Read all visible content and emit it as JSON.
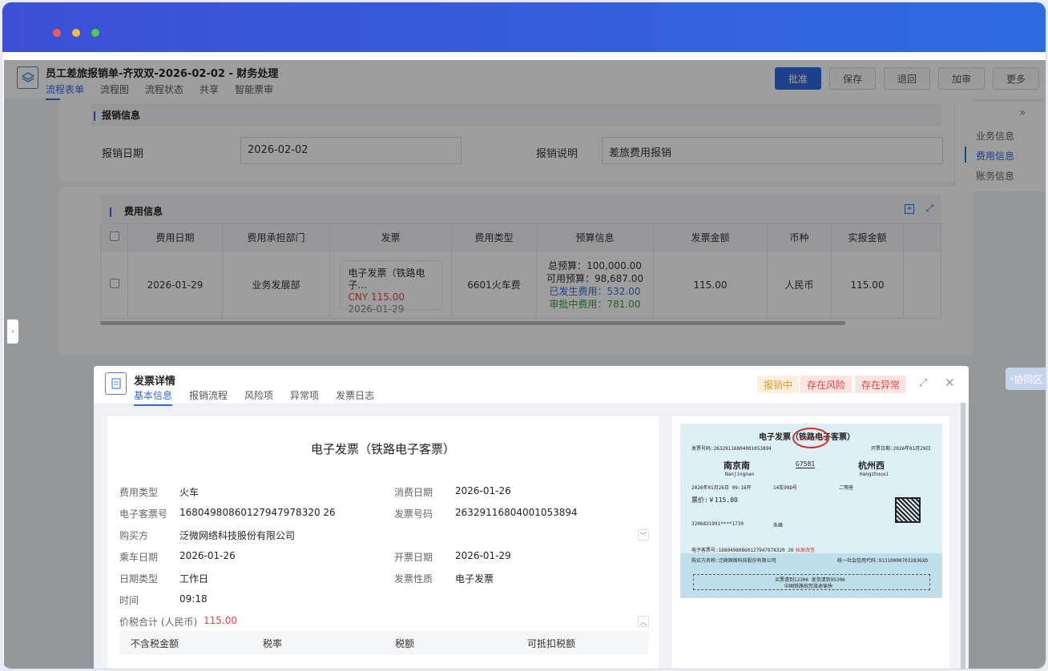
{
  "window": {
    "accent_gradient": [
      "#3d4fd6",
      "#2f6be0"
    ],
    "dots": [
      "#ee5b57",
      "#f6be3d",
      "#57c656"
    ]
  },
  "header": {
    "title": "员工差旅报销单-齐双双-2026-02-02 - 财务处理",
    "tabs": [
      "流程表单",
      "流程图",
      "流程状态",
      "共享",
      "智能票审"
    ],
    "buttons": {
      "approve": "批准",
      "save": "保存",
      "return": "退回",
      "add_review": "加审",
      "more": "更多"
    }
  },
  "reimb": {
    "section_title": "报销信息",
    "date_label": "报销日期",
    "date_value": "2026-02-02",
    "desc_label": "报销说明",
    "desc_value": "差旅费用报销"
  },
  "right_nav": {
    "items": [
      "业务信息",
      "费用信息",
      "账务信息"
    ],
    "active": "费用信息"
  },
  "fee": {
    "section_title": "费用信息",
    "columns": [
      "费用日期",
      "费用承担部门",
      "发票",
      "费用类型",
      "预算信息",
      "发票金额",
      "币种",
      "实报金额"
    ],
    "row": {
      "date": "2026-01-29",
      "dept": "业务发展部",
      "invoice_title": "电子发票（铁路电子...",
      "invoice_amount": "CNY  115.00",
      "invoice_date": "2026-01-29",
      "type": "6601火车费",
      "budget_total": "总预算：100,000.00",
      "budget_available": "可用预算：98,687.00",
      "budget_incurred": "已发生费用：532.00",
      "budget_pending": "审批中费用：781.00",
      "amount": "115.00",
      "currency": "人民币",
      "actual": "115.00"
    }
  },
  "collab_tab": "协同区",
  "modal": {
    "title": "发票详情",
    "tabs": [
      "基本信息",
      "报销流程",
      "风险项",
      "异常项",
      "发票日志"
    ],
    "badges": {
      "reimbursing": "报销中",
      "risk": "存在风险",
      "abnormal": "存在异常"
    },
    "doc_title": "电子发票（铁路电子客票）",
    "fields": {
      "fee_type_label": "费用类型",
      "fee_type": "火车",
      "consume_date_label": "消费日期",
      "consume_date": "2026-01-26",
      "ticket_no_label": "电子客票号",
      "ticket_no": "16804980860127947978320 26",
      "invoice_no_label": "发票号码",
      "invoice_no": "26329116804001053894",
      "buyer_label": "购买方",
      "buyer": "泛微网络科技股份有限公司",
      "ride_date_label": "乘车日期",
      "ride_date": "2026-01-26",
      "issue_date_label": "开票日期",
      "issue_date": "2026-01-29",
      "date_type_label": "日期类型",
      "date_type": "工作日",
      "invoice_nature_label": "发票性质",
      "invoice_nature": "电子发票",
      "time_label": "时间",
      "time": "09:18",
      "total_label": "价税合计 (人民币)",
      "total": "115.00"
    },
    "tax_columns": [
      "不含税金额",
      "税率",
      "税额",
      "可抵扣税额"
    ],
    "ticket": {
      "title": "电子发票（铁路电子客票）",
      "invoice_no": "发票号码:26329116804001053894",
      "issue_date": "开票日期:2026年01月29日",
      "from": "南京南",
      "from_py": "Nanjingnan",
      "train": "G7581",
      "to": "杭州西",
      "to_py": "Hangzhouxi",
      "depart": "2026年01月26日  09:18开",
      "seat": "14车09D号",
      "class": "二等座",
      "price": "票价:￥115.00",
      "id": "3206831991****1739",
      "name": "朱峰",
      "ticket_no": "电子客票号:16804980860127947978320 26",
      "note": "始发改签",
      "buyer": "购买方名称:泛微网络科技股份有限公司",
      "credit": "统一社会信用代码:913100007032836XD",
      "footer1": "买票请到12306 发货请到95306",
      "footer2": "中国铁路祝您旅途愉快",
      "seal": "全国统一发票监制章"
    }
  }
}
